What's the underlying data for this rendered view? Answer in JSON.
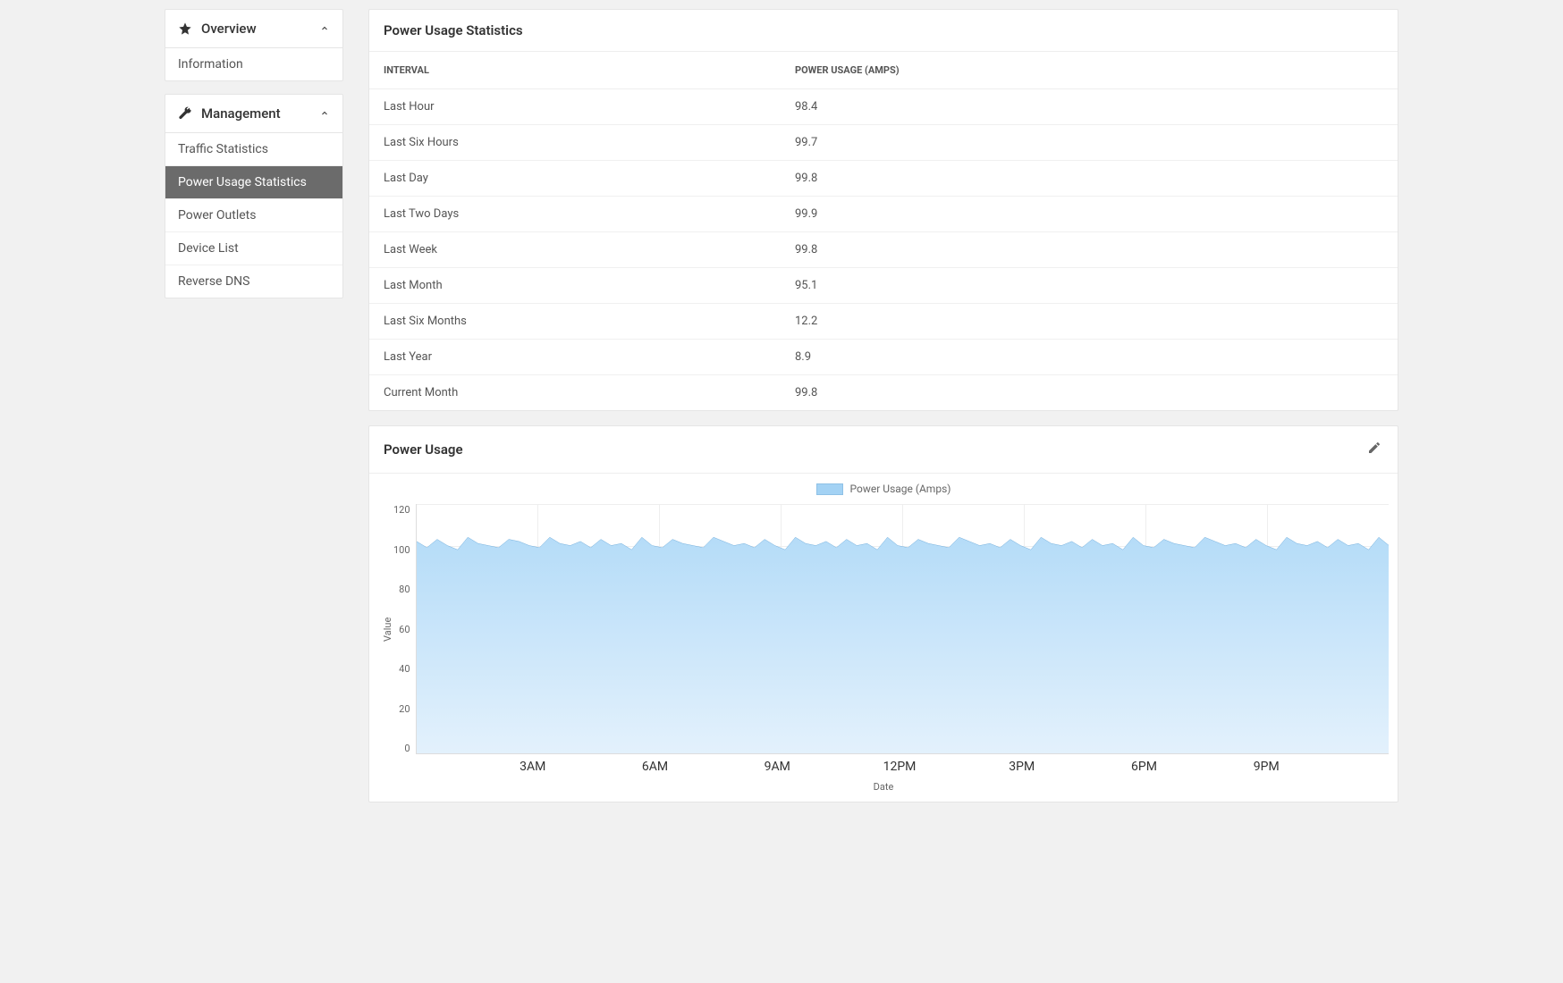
{
  "sidebar": {
    "overview": {
      "title": "Overview",
      "expanded": true,
      "items": [
        {
          "label": "Information",
          "active": false
        }
      ]
    },
    "management": {
      "title": "Management",
      "expanded": true,
      "items": [
        {
          "label": "Traffic Statistics",
          "active": false
        },
        {
          "label": "Power Usage Statistics",
          "active": true
        },
        {
          "label": "Power Outlets",
          "active": false
        },
        {
          "label": "Device List",
          "active": false
        },
        {
          "label": "Reverse DNS",
          "active": false
        }
      ]
    }
  },
  "stats": {
    "title": "Power Usage Statistics",
    "columns": {
      "interval": "INTERVAL",
      "usage": "POWER USAGE (AMPS)"
    },
    "rows": [
      {
        "interval": "Last Hour",
        "usage": "98.4"
      },
      {
        "interval": "Last Six Hours",
        "usage": "99.7"
      },
      {
        "interval": "Last Day",
        "usage": "99.8"
      },
      {
        "interval": "Last Two Days",
        "usage": "99.9"
      },
      {
        "interval": "Last Week",
        "usage": "99.8"
      },
      {
        "interval": "Last Month",
        "usage": "95.1"
      },
      {
        "interval": "Last Six Months",
        "usage": "12.2"
      },
      {
        "interval": "Last Year",
        "usage": "8.9"
      },
      {
        "interval": "Current Month",
        "usage": "99.8"
      }
    ]
  },
  "chart": {
    "title": "Power Usage",
    "legend": "Power Usage (Amps)",
    "ylabel": "Value",
    "xlabel": "Date"
  },
  "chart_data": {
    "type": "area",
    "title": "Power Usage",
    "ylabel": "Value",
    "xlabel": "Date",
    "ylim": [
      0,
      120
    ],
    "x_tick_labels": [
      "3AM",
      "6AM",
      "9AM",
      "12PM",
      "3PM",
      "6PM",
      "9PM"
    ],
    "x_tick_positions_frac": [
      0.125,
      0.25,
      0.375,
      0.5,
      0.625,
      0.75,
      0.875
    ],
    "y_ticks": [
      0,
      20,
      40,
      60,
      80,
      100,
      120
    ],
    "legend": [
      "Power Usage (Amps)"
    ],
    "series": [
      {
        "name": "Power Usage (Amps)",
        "values": [
          102,
          99,
          103,
          100,
          98,
          104,
          101,
          100,
          99,
          103,
          102,
          100,
          99,
          104,
          101,
          100,
          102,
          99,
          103,
          100,
          101,
          98,
          104,
          100,
          99,
          103,
          101,
          100,
          99,
          104,
          102,
          100,
          101,
          99,
          103,
          100,
          98,
          104,
          101,
          100,
          102,
          99,
          103,
          100,
          101,
          98,
          104,
          100,
          99,
          103,
          101,
          100,
          99,
          104,
          102,
          100,
          101,
          99,
          103,
          100,
          98,
          104,
          101,
          100,
          102,
          99,
          103,
          100,
          101,
          98,
          104,
          100,
          99,
          103,
          101,
          100,
          99,
          104,
          102,
          100,
          101,
          99,
          103,
          100,
          98,
          104,
          101,
          100,
          102,
          99,
          103,
          100,
          101,
          98,
          104,
          100
        ]
      }
    ]
  }
}
